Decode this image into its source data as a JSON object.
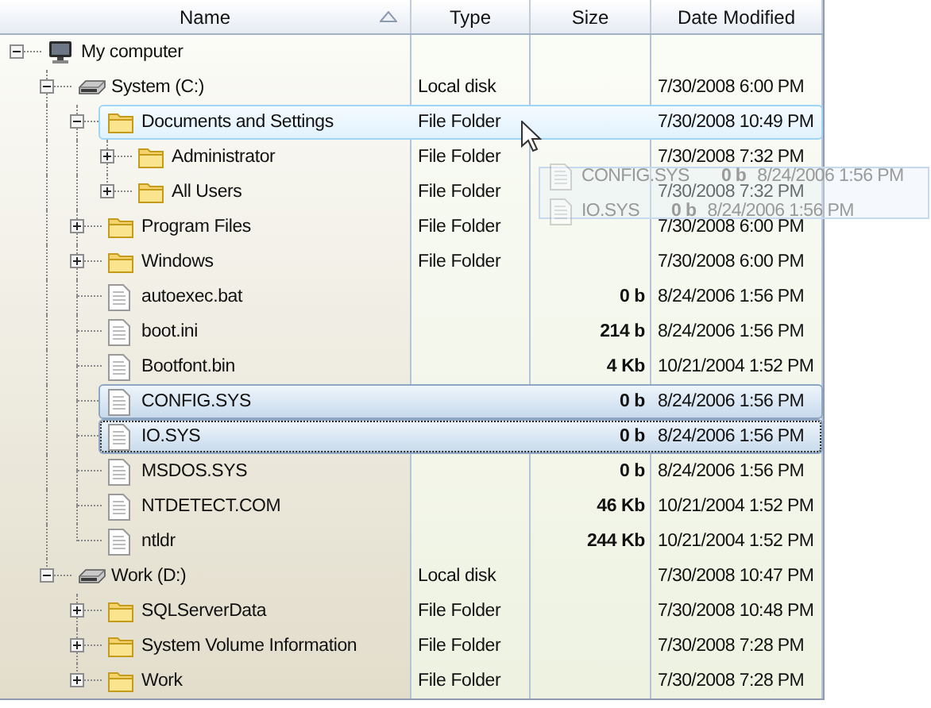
{
  "columns": [
    {
      "label": "Name",
      "sorted": true
    },
    {
      "label": "Type",
      "sorted": false
    },
    {
      "label": "Size",
      "sorted": false
    },
    {
      "label": "Date Modified",
      "sorted": false
    }
  ],
  "tree": [
    {
      "kind": "computer",
      "name": "My computer",
      "expanded": true,
      "selected": false,
      "hovered": false,
      "focused": false,
      "children": [
        {
          "kind": "drive",
          "name": "System (C:)",
          "type": "Local disk",
          "date": "7/30/2008 6:00 PM",
          "expanded": true,
          "selected": false,
          "hovered": false,
          "focused": false,
          "children": [
            {
              "kind": "folder",
              "name": "Documents and Settings",
              "type": "File Folder",
              "date": "7/30/2008 10:49 PM",
              "expanded": true,
              "selected": false,
              "hovered": true,
              "focused": false,
              "children": [
                {
                  "kind": "folder",
                  "name": "Administrator",
                  "type": "File Folder",
                  "date": "7/30/2008 7:32 PM",
                  "expanded": false,
                  "selected": false,
                  "hovered": false,
                  "focused": false
                },
                {
                  "kind": "folder",
                  "name": "All Users",
                  "type": "File Folder",
                  "date": "7/30/2008 7:32 PM",
                  "expanded": false,
                  "selected": false,
                  "hovered": false,
                  "focused": false
                }
              ]
            },
            {
              "kind": "folder",
              "name": "Program Files",
              "type": "File Folder",
              "date": "7/30/2008 6:00 PM",
              "expanded": false,
              "selected": false,
              "hovered": false,
              "focused": false
            },
            {
              "kind": "folder",
              "name": "Windows",
              "type": "File Folder",
              "date": "7/30/2008 6:00 PM",
              "expanded": false,
              "selected": false,
              "hovered": false,
              "focused": false
            },
            {
              "kind": "file",
              "name": "autoexec.bat",
              "size": "0 b",
              "date": "8/24/2006 1:56 PM",
              "selected": false,
              "hovered": false,
              "focused": false
            },
            {
              "kind": "file",
              "name": "boot.ini",
              "size": "214 b",
              "date": "8/24/2006 1:56 PM",
              "selected": false,
              "hovered": false,
              "focused": false
            },
            {
              "kind": "file",
              "name": "Bootfont.bin",
              "size": "4 Kb",
              "date": "10/21/2004 1:52 PM",
              "selected": false,
              "hovered": false,
              "focused": false
            },
            {
              "kind": "file",
              "name": "CONFIG.SYS",
              "size": "0 b",
              "date": "8/24/2006 1:56 PM",
              "selected": true,
              "hovered": false,
              "focused": false
            },
            {
              "kind": "file",
              "name": "IO.SYS",
              "size": "0 b",
              "date": "8/24/2006 1:56 PM",
              "selected": true,
              "hovered": false,
              "focused": true
            },
            {
              "kind": "file",
              "name": "MSDOS.SYS",
              "size": "0 b",
              "date": "8/24/2006 1:56 PM",
              "selected": false,
              "hovered": false,
              "focused": false
            },
            {
              "kind": "file",
              "name": "NTDETECT.COM",
              "size": "46 Kb",
              "date": "10/21/2004 1:52 PM",
              "selected": false,
              "hovered": false,
              "focused": false
            },
            {
              "kind": "file",
              "name": "ntldr",
              "size": "244 Kb",
              "date": "10/21/2004 1:52 PM",
              "selected": false,
              "hovered": false,
              "focused": false
            }
          ]
        },
        {
          "kind": "drive",
          "name": "Work (D:)",
          "type": "Local disk",
          "date": "7/30/2008 10:47 PM",
          "expanded": true,
          "selected": false,
          "hovered": false,
          "focused": false,
          "children": [
            {
              "kind": "folder",
              "name": "SQLServerData",
              "type": "File Folder",
              "date": "7/30/2008 10:48 PM",
              "expanded": false,
              "selected": false,
              "hovered": false,
              "focused": false
            },
            {
              "kind": "folder",
              "name": "System Volume Information",
              "type": "File Folder",
              "date": "7/30/2008 7:28 PM",
              "expanded": false,
              "selected": false,
              "hovered": false,
              "focused": false
            },
            {
              "kind": "folder",
              "name": "Work",
              "type": "File Folder",
              "date": "7/30/2008 7:28 PM",
              "expanded": false,
              "selected": false,
              "hovered": false,
              "focused": false
            }
          ]
        }
      ]
    }
  ],
  "drag_preview": [
    {
      "kind": "file",
      "name": "CONFIG.SYS",
      "size": "0 b",
      "date": "8/24/2006 1:56 PM"
    },
    {
      "kind": "file",
      "name": "IO.SYS",
      "size": "0 b",
      "date": "8/24/2006 1:56 PM"
    }
  ]
}
